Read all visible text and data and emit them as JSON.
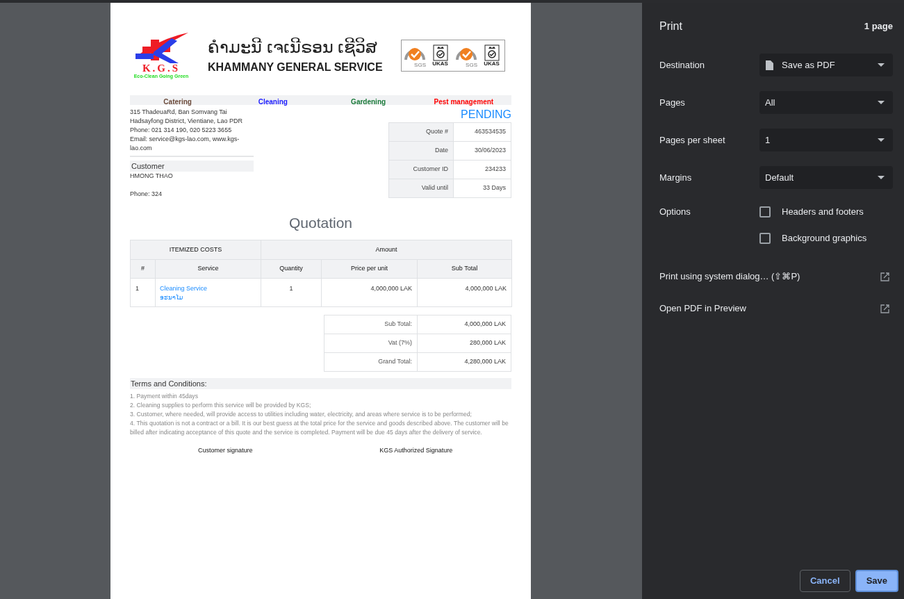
{
  "document": {
    "header": {
      "logo_initials": "K.G.S",
      "logo_tagline": "Eco-Clean Going Green",
      "name_lao": "ຄຳມະນີ ເຈເນີຣອນ ເຊີວິສ",
      "name_en": "KHAMMANY GENERAL SERVICE",
      "certifications": [
        {
          "kind": "sgs",
          "label": "SGS"
        },
        {
          "kind": "ukas",
          "label": "UKAS"
        },
        {
          "kind": "sgs",
          "label": "SGS"
        },
        {
          "kind": "ukas",
          "label": "UKAS"
        }
      ]
    },
    "services": [
      {
        "label": "Catering",
        "color": "#6b4a3a"
      },
      {
        "label": "Cleaning",
        "color": "#1a1aff"
      },
      {
        "label": "Gardening",
        "color": "#1a7a3a"
      },
      {
        "label": "Pest management",
        "color": "#ff0000"
      }
    ],
    "address_lines": [
      "315 ThadeuaRd, Ban Somvang Tai",
      "Hadsayfong District, Vientiane, Lao PDR",
      "Phone: 021 314 190, 020 5223 3655",
      "Email: service@kgs-lao.com, www.kgs-",
      "lao.com"
    ],
    "customer": {
      "heading": "Customer",
      "name": "HMONG THAO",
      "phone": "Phone: 324"
    },
    "status": "PENDING",
    "meta": [
      {
        "label": "Quote #",
        "value": "463534535"
      },
      {
        "label": "Date",
        "value": "30/06/2023"
      },
      {
        "label": "Customer ID",
        "value": "234233"
      },
      {
        "label": "Valid until",
        "value": "33 Days"
      }
    ],
    "title": "Quotation",
    "items_table": {
      "group_headers": [
        "ITEMIZED COSTS",
        "Amount"
      ],
      "columns": [
        "#",
        "Service",
        "Quantity",
        "Price per unit",
        "Sub Total"
      ],
      "rows": [
        {
          "number": "1",
          "service": "Cleaning Service",
          "service_lao": "ອະນາໄມ",
          "quantity": "1",
          "price": "4,000,000 LAK",
          "subtotal": "4,000,000 LAK"
        }
      ]
    },
    "totals": [
      {
        "label": "Sub Total:",
        "value": "4,000,000 LAK"
      },
      {
        "label": "Vat (7%)",
        "value": "280,000 LAK"
      },
      {
        "label": "Grand Total:",
        "value": "4,280,000 LAK"
      }
    ],
    "terms": {
      "heading": "Terms and Conditions:",
      "lines": [
        "1. Payment within 45days",
        "2. Cleaning supplies to perform this service will be provided by KGS;",
        "3. Customer, where needed, will provide access to utilities including water, electricity, and areas where service is to be performed;",
        "4. This quotation is not a contract or a bill. It is our best guess at the total price for the service and goods described above. The customer will be billed after indicating acceptance of this quote and the service is completed. Payment will be due 45 days after the delivery of service."
      ]
    },
    "signatures": [
      "Customer signature",
      "KGS Authorized Signature"
    ]
  },
  "print_panel": {
    "title": "Print",
    "page_count": "1 page",
    "settings": [
      {
        "label": "Destination",
        "value": "Save as PDF",
        "kind": "file"
      },
      {
        "label": "Pages",
        "value": "All",
        "kind": "plain"
      },
      {
        "label": "Pages per sheet",
        "value": "1",
        "kind": "plain"
      },
      {
        "label": "Margins",
        "value": "Default",
        "kind": "plain"
      }
    ],
    "options_label": "Options",
    "options": [
      {
        "label": "Headers and footers",
        "checked": false
      },
      {
        "label": "Background graphics",
        "checked": false
      }
    ],
    "links": [
      "Print using system dialog… (⇧⌘P)",
      "Open PDF in Preview"
    ],
    "buttons": [
      {
        "label": "Cancel",
        "kind": "secondary"
      },
      {
        "label": "Save",
        "kind": "primary"
      }
    ]
  }
}
